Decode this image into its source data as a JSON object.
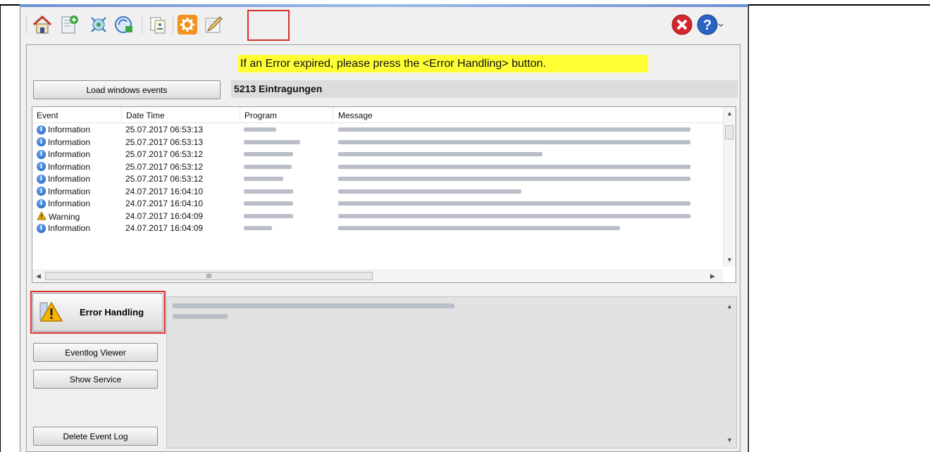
{
  "toolbar": {
    "icons": [
      "home-icon",
      "new-document-icon",
      "network-icon",
      "transfer-icon",
      "copy-icon",
      "settings-icon",
      "edit-log-icon",
      "close-icon",
      "help-icon"
    ]
  },
  "notice": "If an Error expired, please press the <Error Handling> button.",
  "buttons": {
    "load_events": "Load windows events",
    "error_handling": "Error Handling",
    "eventlog_viewer": "Eventlog Viewer",
    "show_service": "Show Service",
    "delete_event_log": "Delete Event Log"
  },
  "entry_count": "5213 Eintragungen",
  "table": {
    "columns": [
      "Event",
      "Date Time",
      "Program",
      "Message"
    ],
    "rows": [
      {
        "event": "Information",
        "time": "25.07.2017 06:53:13",
        "level": "info"
      },
      {
        "event": "Information",
        "time": "25.07.2017 06:53:13",
        "level": "info"
      },
      {
        "event": "Information",
        "time": "25.07.2017 06:53:12",
        "level": "info"
      },
      {
        "event": "Information",
        "time": "25.07.2017 06:53:12",
        "level": "info"
      },
      {
        "event": "Information",
        "time": "25.07.2017 06:53:12",
        "level": "info"
      },
      {
        "event": "Information",
        "time": "24.07.2017 16:04:10",
        "level": "info"
      },
      {
        "event": "Information",
        "time": "24.07.2017 16:04:10",
        "level": "info"
      },
      {
        "event": "Warning",
        "time": "24.07.2017 16:04:09",
        "level": "warning"
      },
      {
        "event": "Information",
        "time": "24.07.2017 16:04:09",
        "level": "info"
      }
    ]
  },
  "scroll_thumb_text": "III",
  "colors": {
    "notice_bg": "#ffff33",
    "highlight": "#d9302c",
    "info": "#1f5cc0",
    "warning": "#f0b400",
    "close_red": "#d4262c",
    "help_blue": "#2a63c4"
  }
}
